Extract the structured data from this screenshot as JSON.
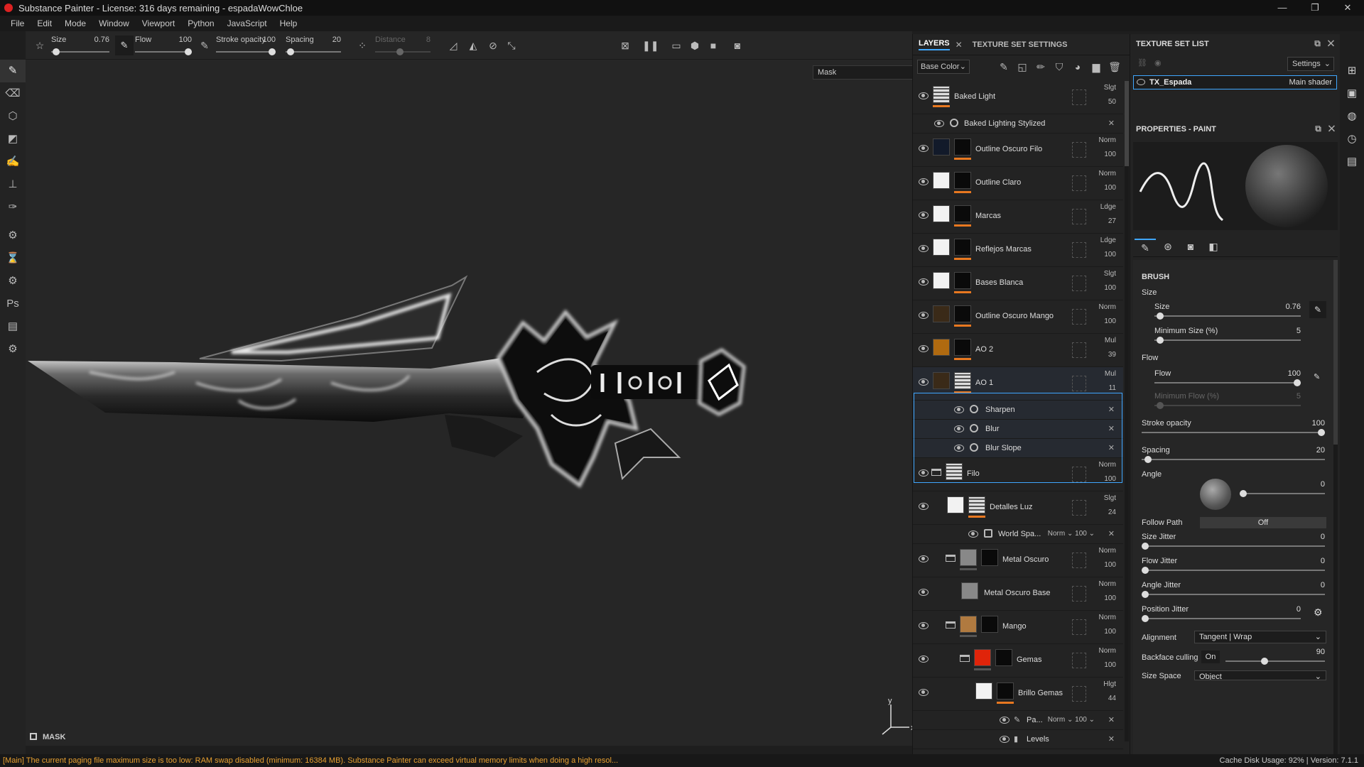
{
  "window": {
    "title": "Substance Painter - License: 316 days remaining - espadaWowChloe",
    "controls": [
      "—",
      "❐",
      "✕"
    ]
  },
  "menu": [
    "File",
    "Edit",
    "Mode",
    "Window",
    "Viewport",
    "Python",
    "JavaScript",
    "Help"
  ],
  "toolbar": {
    "size_label": "Size",
    "size_value": "0.76",
    "flow_label": "Flow",
    "flow_value": "100",
    "stroke_opacity_label": "Stroke opacity",
    "stroke_opacity_value": "100",
    "spacing_label": "Spacing",
    "spacing_value": "20",
    "distance_label": "Distance",
    "distance_value": "8"
  },
  "viewport": {
    "mask_select": "Mask",
    "mask_label": "MASK",
    "axis_y": "y",
    "axis_x": "x"
  },
  "layers_panel": {
    "tab_layers": "LAYERS",
    "tab_texture_settings": "TEXTURE SET SETTINGS",
    "channel": "Base Color",
    "rows": [
      {
        "name": "Baked Light",
        "blend": "Slgt",
        "opacity": "50"
      },
      {
        "name": "Baked Lighting Stylized"
      },
      {
        "name": "Outline Oscuro Filo",
        "blend": "Norm",
        "opacity": "100"
      },
      {
        "name": "Outline Claro",
        "blend": "Norm",
        "opacity": "100"
      },
      {
        "name": "Marcas",
        "blend": "Ldge",
        "opacity": "27"
      },
      {
        "name": "Reflejos Marcas",
        "blend": "Ldge",
        "opacity": "100"
      },
      {
        "name": "Bases Blanca",
        "blend": "Slgt",
        "opacity": "100"
      },
      {
        "name": "Outline Oscuro Mango",
        "blend": "Norm",
        "opacity": "100"
      },
      {
        "name": "AO 2",
        "blend": "Mul",
        "opacity": "39"
      },
      {
        "name": "AO 1",
        "blend": "Mul",
        "opacity": "11"
      },
      {
        "name": "Sharpen"
      },
      {
        "name": "Blur"
      },
      {
        "name": "Blur Slope"
      },
      {
        "name": "Filo",
        "blend": "Norm",
        "opacity": "100"
      },
      {
        "name": "Detalles Luz",
        "blend": "Slgt",
        "opacity": "24"
      },
      {
        "name": "World Spa...",
        "blend": "Norm",
        "opacity": "100"
      },
      {
        "name": "Metal Oscuro",
        "blend": "Norm",
        "opacity": "100"
      },
      {
        "name": "Metal Oscuro Base",
        "blend": "Norm",
        "opacity": "100"
      },
      {
        "name": "Mango",
        "blend": "Norm",
        "opacity": "100"
      },
      {
        "name": "Gemas",
        "blend": "Norm",
        "opacity": "100"
      },
      {
        "name": "Brillo Gemas",
        "blend": "Hlgt",
        "opacity": "44"
      },
      {
        "name": "Pa...",
        "blend": "Norm",
        "opacity": "100"
      },
      {
        "name": "Levels"
      }
    ]
  },
  "texture_set_list": {
    "title": "TEXTURE SET LIST",
    "settings": "Settings",
    "item_name": "TX_Espada",
    "item_shader": "Main shader"
  },
  "properties": {
    "title": "PROPERTIES - PAINT",
    "brush_section": "BRUSH",
    "size_group": "Size",
    "size_label": "Size",
    "size_value": "0.76",
    "min_size_label": "Minimum Size (%)",
    "min_size_value": "5",
    "flow_group": "Flow",
    "flow_label": "Flow",
    "flow_value": "100",
    "min_flow_label": "Minimum Flow (%)",
    "min_flow_value": "5",
    "stroke_opacity_label": "Stroke opacity",
    "stroke_opacity_value": "100",
    "spacing_label": "Spacing",
    "spacing_value": "20",
    "angle_label": "Angle",
    "angle_value": "0",
    "follow_path_label": "Follow Path",
    "follow_path_value": "Off",
    "size_jitter_label": "Size Jitter",
    "size_jitter_value": "0",
    "flow_jitter_label": "Flow Jitter",
    "flow_jitter_value": "0",
    "angle_jitter_label": "Angle Jitter",
    "angle_jitter_value": "0",
    "position_jitter_label": "Position Jitter",
    "position_jitter_value": "0",
    "alignment_label": "Alignment",
    "alignment_value": "Tangent | Wrap",
    "backface_label": "Backface culling",
    "backface_value": "On",
    "backface_angle": "90",
    "size_space_label": "Size Space",
    "size_space_value": "Object"
  },
  "status": {
    "message": "[Main] The current paging file maximum size is too low: RAM swap disabled (minimum: 16384 MB). Substance Painter can exceed virtual memory limits when doing a high resol...",
    "right": "Cache Disk Usage:  92% | Version: 7.1.1"
  },
  "colors": {
    "accent": "#3fa7ff",
    "warning": "#e8a030",
    "orange_mask": "#e87820"
  }
}
